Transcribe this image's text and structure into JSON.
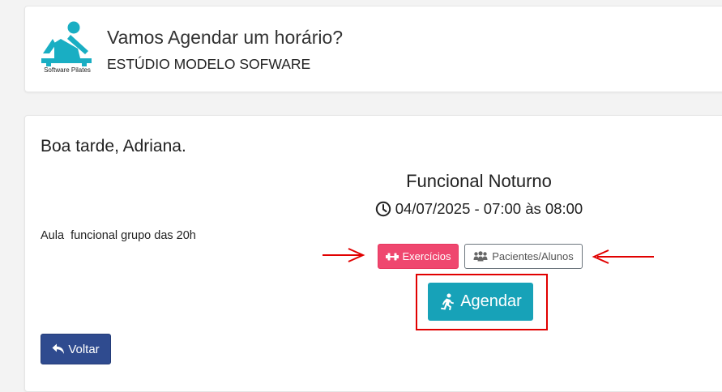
{
  "header": {
    "logo_text": "Software Pilates",
    "title": "Vamos Agendar um horário?",
    "studio_name": "ESTÚDIO MODELO SOFWARE"
  },
  "main": {
    "greeting": "Boa tarde, Adriana.",
    "class_name": "Funcional Noturno",
    "datetime": "04/07/2025 - 07:00 às 08:00",
    "description": "Aula  funcional grupo das 20h",
    "exercises_button": "Exercícios",
    "patients_button": "Pacientes/Alunos",
    "schedule_button": "Agendar",
    "back_button": "Voltar"
  },
  "colors": {
    "page_bg": "#f3f3f3",
    "card_bg": "#ffffff",
    "logo_teal": "#19aec3",
    "exercises_btn": "#ef476f",
    "schedule_btn": "#17a2b8",
    "back_btn": "#2f4b8f",
    "annotation_red": "#e10000"
  },
  "icons": {
    "clock": "clock-icon",
    "exercises": "dumbbell-icon",
    "patients": "users-icon",
    "schedule": "running-person-icon",
    "back": "reply-arrow-icon"
  }
}
